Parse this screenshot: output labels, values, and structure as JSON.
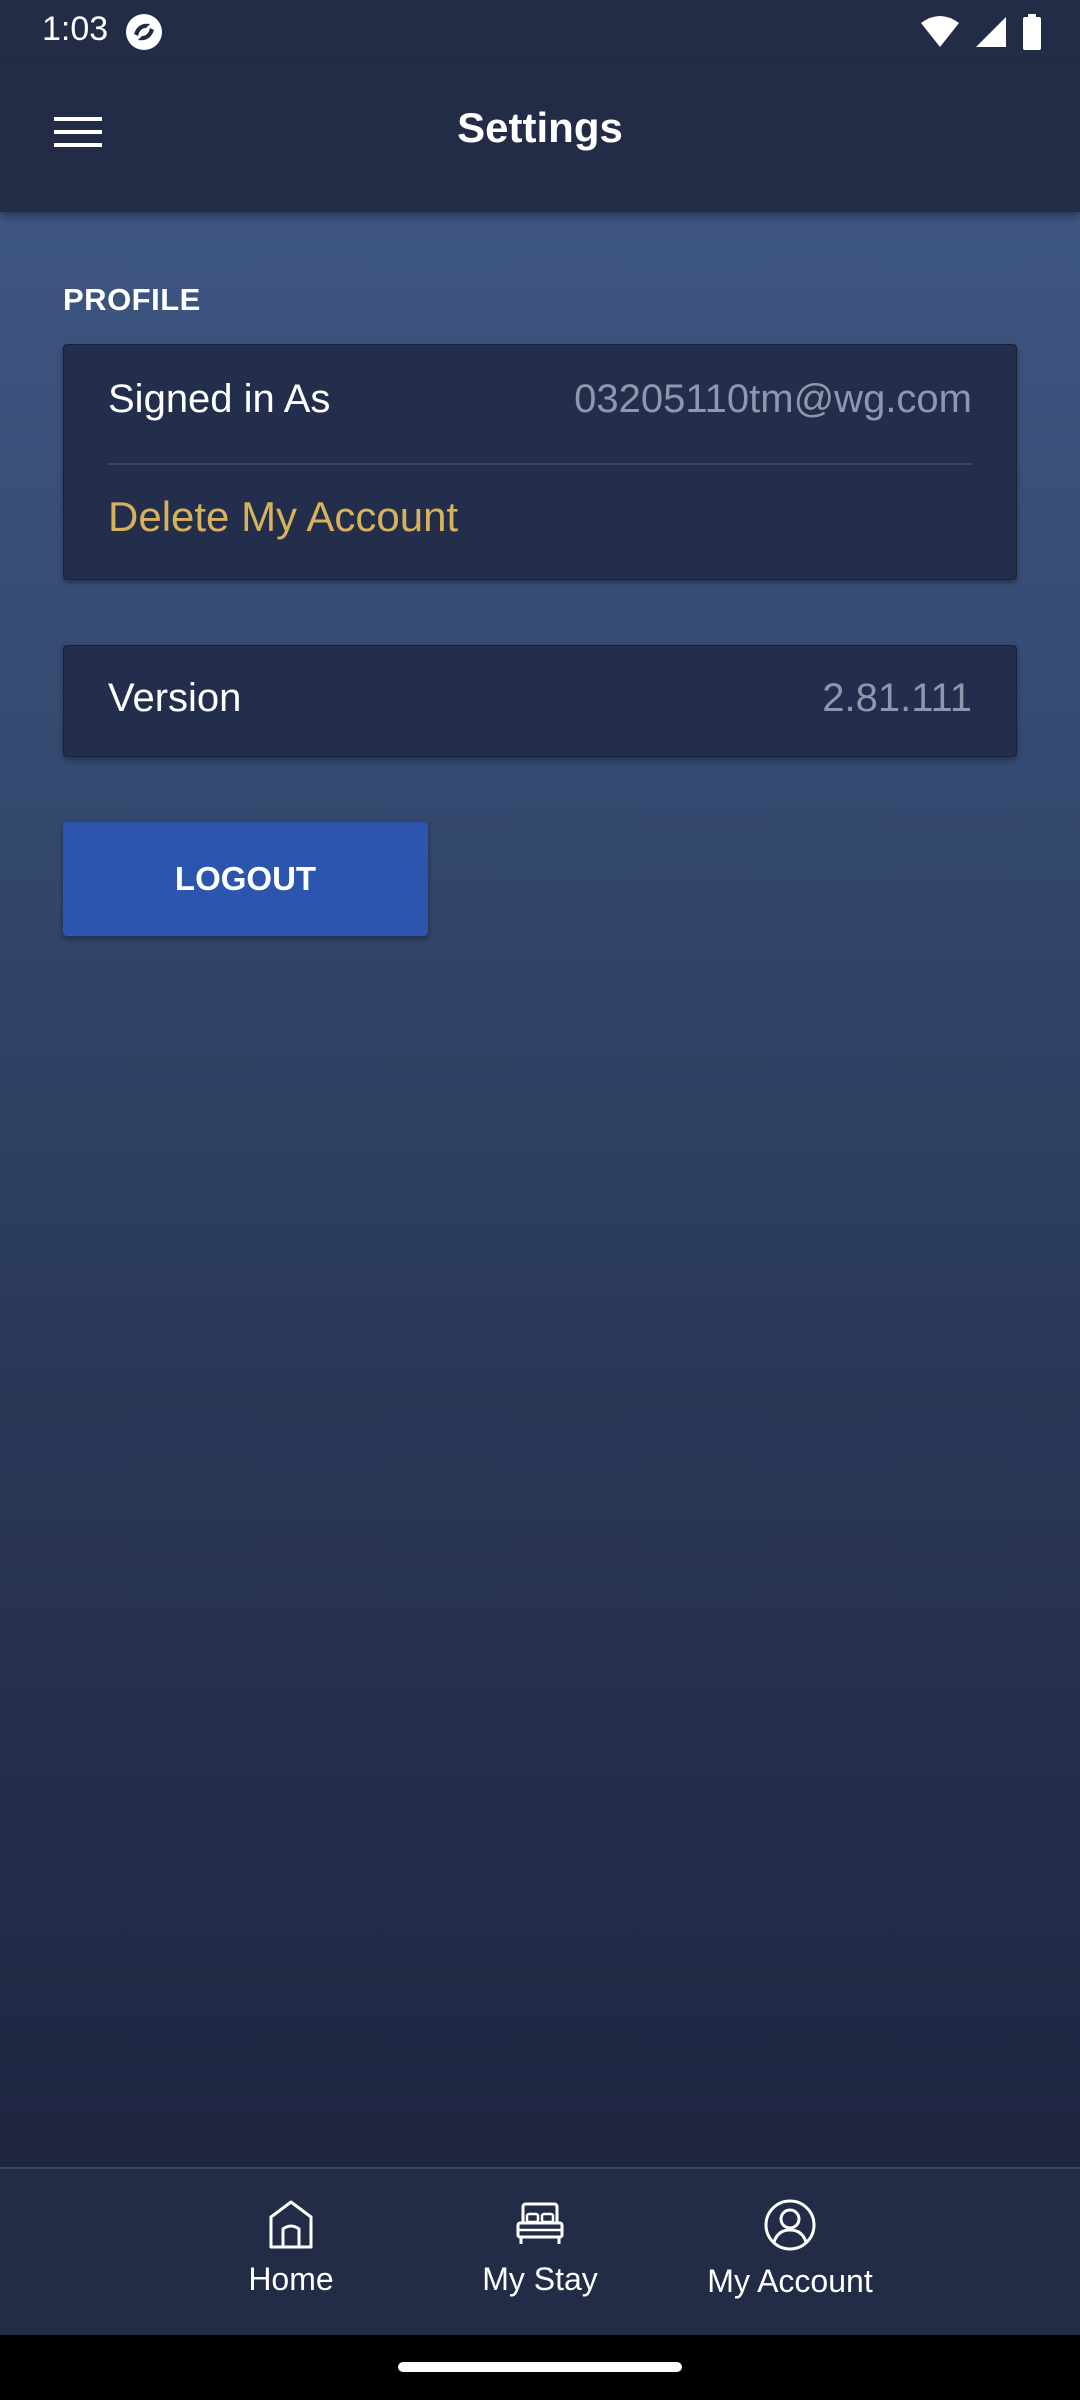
{
  "status_bar": {
    "time": "1:03",
    "icons": [
      "app-notification-icon",
      "wifi-icon",
      "cellular-signal-icon",
      "battery-icon"
    ]
  },
  "app_bar": {
    "title": "Settings",
    "menu_icon": "hamburger-menu-icon"
  },
  "profile": {
    "section_label": "PROFILE",
    "signed_in_label": "Signed in As",
    "signed_in_value": "03205110tm@wg.com",
    "delete_account_label": "Delete My Account"
  },
  "version": {
    "label": "Version",
    "value": "2.81.111"
  },
  "logout": {
    "label": "LOGOUT"
  },
  "bottom_nav": {
    "items": [
      {
        "label": "Home",
        "icon": "home-icon"
      },
      {
        "label": "My Stay",
        "icon": "bed-icon"
      },
      {
        "label": "My Account",
        "icon": "account-circle-icon"
      }
    ]
  },
  "colors": {
    "app_bar": "#232c47",
    "gradient_top": "#3d5581",
    "gradient_bottom": "#1f2541",
    "card": "#222e4b",
    "delete_link": "#d8b25a",
    "logout_button": "#2c56ad",
    "secondary_text": "#8e97ab"
  }
}
